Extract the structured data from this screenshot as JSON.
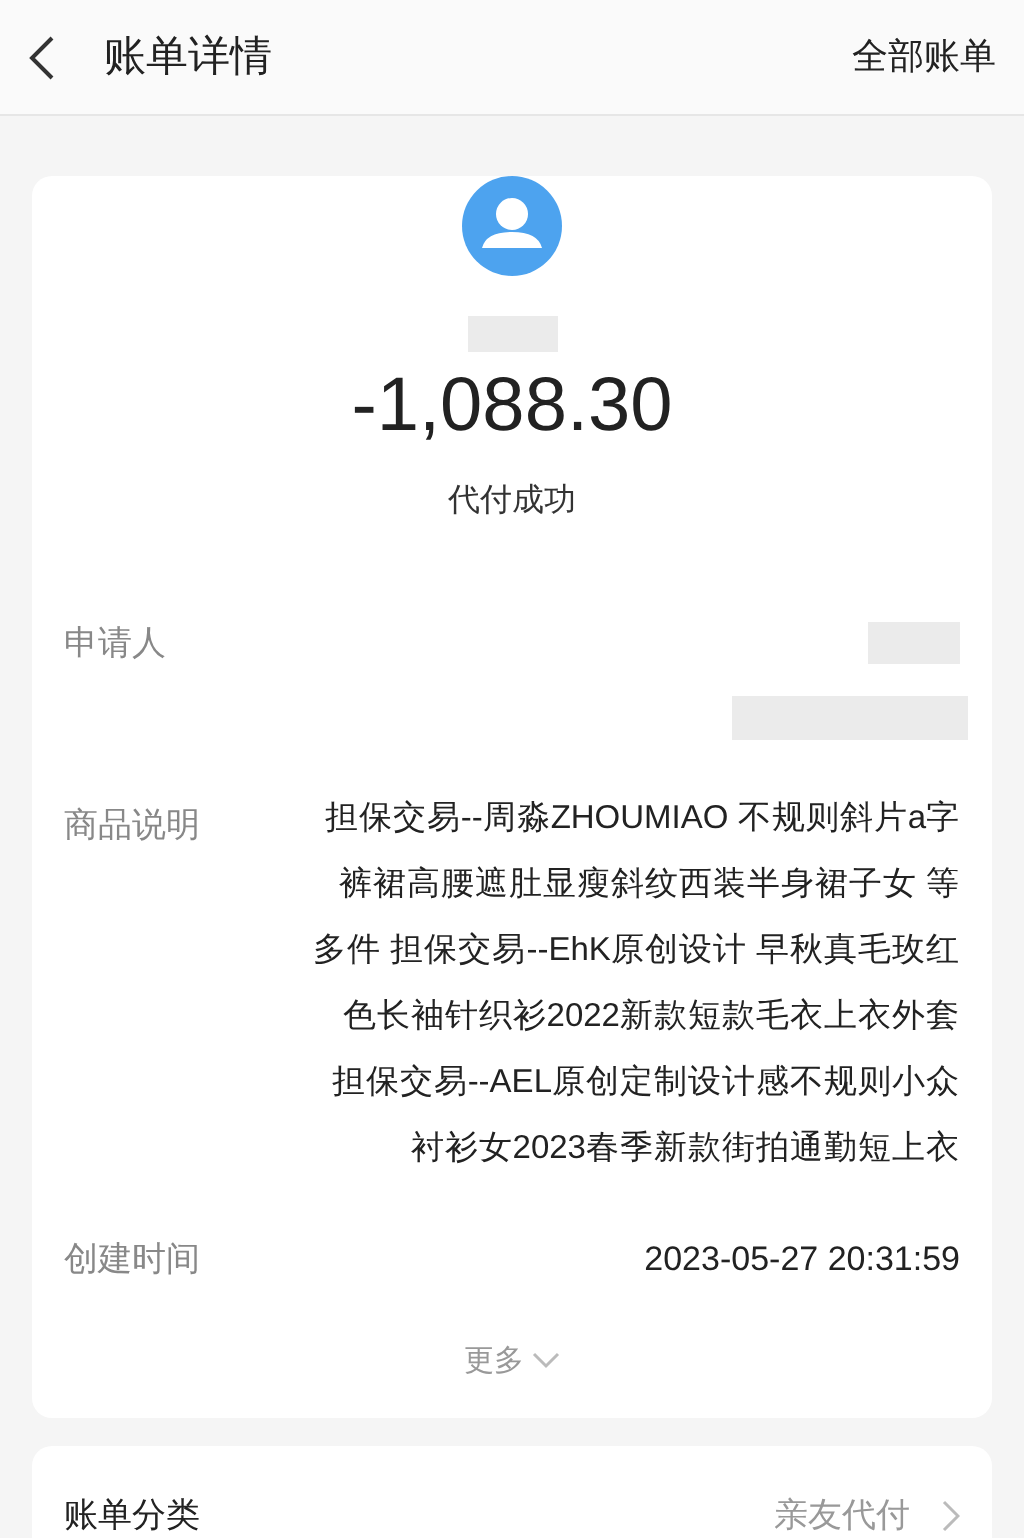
{
  "header": {
    "title": "账单详情",
    "action": "全部账单"
  },
  "summary": {
    "amount": "-1,088.30",
    "status": "代付成功"
  },
  "fields": [
    {
      "kind": "redacted",
      "label": "申请人"
    },
    {
      "kind": "lines",
      "label": "商品说明",
      "lines": [
        "担保交易--周淼ZHOUMIAO 不规则斜片a字",
        "裤裙高腰遮肚显瘦斜纹西装半身裙子女 等",
        "多件 担保交易--EhK原创设计 早秋真毛玫红",
        "色长袖针织衫2022新款短款毛衣上衣外套",
        "担保交易--AEL原创定制设计感不规则小众",
        "衬衫女2023春季新款街拍通勤短上衣"
      ]
    },
    {
      "kind": "text",
      "label": "创建时间",
      "value": "2023-05-27 20:31:59"
    }
  ],
  "more": {
    "label": "更多",
    "expanded": false
  },
  "category": {
    "label": "账单分类",
    "value": "亲友代付"
  }
}
